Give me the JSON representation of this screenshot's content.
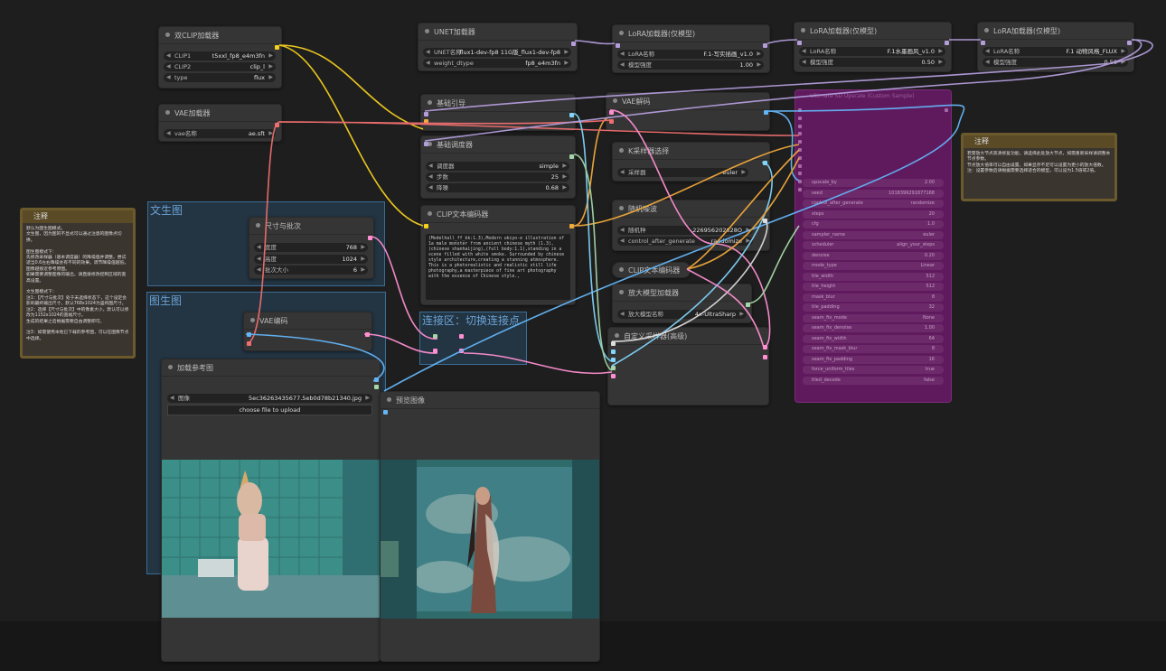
{
  "groups": {
    "txt2img": "文生图",
    "img2img": "图生图",
    "connect": "连接区：切换连接点"
  },
  "nodes": {
    "dual_clip": {
      "title": "双CLIP加载器",
      "widgets": [
        {
          "label": "CLIP1",
          "value": "t5xxl_fp8_e4m3fn"
        },
        {
          "label": "CLIP2",
          "value": "clip_l"
        },
        {
          "label": "type",
          "value": "flux"
        }
      ]
    },
    "vae_loader": {
      "title": "VAE加载器",
      "widgets": [
        {
          "label": "vae名称",
          "value": "ae.sft"
        }
      ]
    },
    "unet": {
      "title": "UNET加载器",
      "widgets": [
        {
          "label": "UNET名称",
          "value": "flux1-dev-fp8 11G版_flux1-dev-fp8"
        },
        {
          "label": "weight_dtype",
          "value": "fp8_e4m3fn"
        }
      ]
    },
    "lora1": {
      "title": "LoRA加载器(仅模型)",
      "widgets": [
        {
          "label": "LoRA名称",
          "value": "F.1-写实插画_v1.0"
        },
        {
          "label": "模型强度",
          "value": "1.00"
        }
      ]
    },
    "lora2": {
      "title": "LoRA加载器(仅模型)",
      "widgets": [
        {
          "label": "LoRA名称",
          "value": "F.1水墨画风_v1.0"
        },
        {
          "label": "模型强度",
          "value": "0.50"
        }
      ]
    },
    "lora3": {
      "title": "LoRA加载器(仅模型)",
      "widgets": [
        {
          "label": "LoRA名称",
          "value": "F.1  动物风格_FLUX"
        },
        {
          "label": "模型强度",
          "value": "0.50"
        }
      ]
    },
    "guider": {
      "title": "基础引导"
    },
    "scheduler": {
      "title": "基础调度器",
      "widgets": [
        {
          "label": "调度器",
          "value": "simple"
        },
        {
          "label": "步数",
          "value": "25"
        },
        {
          "label": "降噪",
          "value": "0.68"
        }
      ]
    },
    "vae_decode": {
      "title": "VAE解码"
    },
    "ksampler_select": {
      "title": "K采样器选择",
      "widgets": [
        {
          "label": "采样器",
          "value": "euler"
        }
      ]
    },
    "noise": {
      "title": "随机噪波",
      "widgets": [
        {
          "label": "随机种",
          "value": "226956202628O"
        },
        {
          "label": "control_after_generate",
          "value": "randomize"
        }
      ]
    },
    "clip_encode": {
      "title": "CLIP文本编码器",
      "text": "(Modelhall_ff_kk:1.3),Modern ukiyo-e illustration of 1a male monster from ancient chinese myth (1.3),(chinese shanhaijing),(full body:1.1),standing in a scene filled with white smoke. Surrounded by chinese style architecture,creating a stunning atmosphere. This is a photorealistic and realistic still life photography,a masterpiece of fine art photography with the essence of Chinese style.,"
    },
    "clip_encode2": {
      "title": "CLIP文本编码器"
    },
    "size": {
      "title": "尺寸与批次",
      "widgets": [
        {
          "label": "宽度",
          "value": "768"
        },
        {
          "label": "高度",
          "value": "1024"
        },
        {
          "label": "批次大小",
          "value": "6"
        }
      ]
    },
    "vae_encode": {
      "title": "VAE编码"
    },
    "load_image": {
      "title": "加载参考图",
      "widgets": [
        {
          "label": "图像",
          "value": "5ec36263435677.5eb0d78b21340.jpg"
        }
      ],
      "upload": "choose file to upload"
    },
    "preview": {
      "title": "预览图像"
    },
    "upscale_loader": {
      "title": "放大模型加载器",
      "widgets": [
        {
          "label": "放大模型名称",
          "value": "4x-UltraSharp"
        }
      ]
    },
    "custom_sampler": {
      "title": "自定义采样器(高级)"
    },
    "ultimate": {
      "title": "Ultimate SD Upscale (Custom Sample)",
      "widgets": [
        {
          "label": "upscale_by",
          "value": "2.00"
        },
        {
          "label": "seed",
          "value": "1018399291877168"
        },
        {
          "label": "control_after_generate",
          "value": "randomize"
        },
        {
          "label": "steps",
          "value": "20"
        },
        {
          "label": "cfg",
          "value": "1.0"
        },
        {
          "label": "sampler_name",
          "value": "euler"
        },
        {
          "label": "scheduler",
          "value": "align_your_steps"
        },
        {
          "label": "denoise",
          "value": "0.20"
        },
        {
          "label": "mode_type",
          "value": "Linear"
        },
        {
          "label": "tile_width",
          "value": "512"
        },
        {
          "label": "tile_height",
          "value": "512"
        },
        {
          "label": "mask_blur",
          "value": "8"
        },
        {
          "label": "tile_padding",
          "value": "32"
        },
        {
          "label": "seam_fix_mode",
          "value": "None"
        },
        {
          "label": "seam_fix_denoise",
          "value": "1.00"
        },
        {
          "label": "seam_fix_width",
          "value": "64"
        },
        {
          "label": "seam_fix_mask_blur",
          "value": "8"
        },
        {
          "label": "seam_fix_padding",
          "value": "16"
        },
        {
          "label": "force_uniform_tiles",
          "value": "true"
        },
        {
          "label": "tiled_decode",
          "value": "false"
        }
      ]
    }
  },
  "notes": {
    "left": {
      "title": "注释",
      "text": "默认为图生图模式。\n文生图，因为图的不显式可以通过注意的图像点切换。\n\n图生图模式下：\n先修改采样器（基本调度器）的降噪值并调整。尝试适当0.6左右降噪会有不同的效果。调节降噪值越低，图像越接近参考原图。\n如果需要调整图像的输出，请直接修改控制区域的宽高设置。\n\n文生图模式下：\n注1：【尺寸与批次】处于未选择状态下，这个设定会影响最终输出尺寸，默认768x1024为竖构图尺寸。\n注2：选择【尺寸与批次】中的像素大小，默认可以修改为1152x1024的宽幅尺寸。\n生成的结果之后根据需要自由调整即可。\n\n注3：如需使用本地已下载的参考图，可以在图像节点中选择。"
    },
    "right": {
      "title": "注释",
      "text": "若需放大节点高清修复功能，请选择此处放大节点，如需重新采样请调整本节点参数。\n节点放大倍率可以自由设置，如果显存不足可以设置为更小的放大倍数。\n注：设置参数后请根据需要选择适合的模型，可以设为1.5倍或2倍。"
    }
  },
  "colors": {
    "clip": "#f5d020",
    "vae": "#ef6f6f",
    "model": "#b39ddb",
    "cond": "#f2a93b",
    "latent": "#ff8fd2",
    "image": "#64b5f6",
    "noise": "#a5d6a7",
    "sampler": "#81d4fa"
  }
}
